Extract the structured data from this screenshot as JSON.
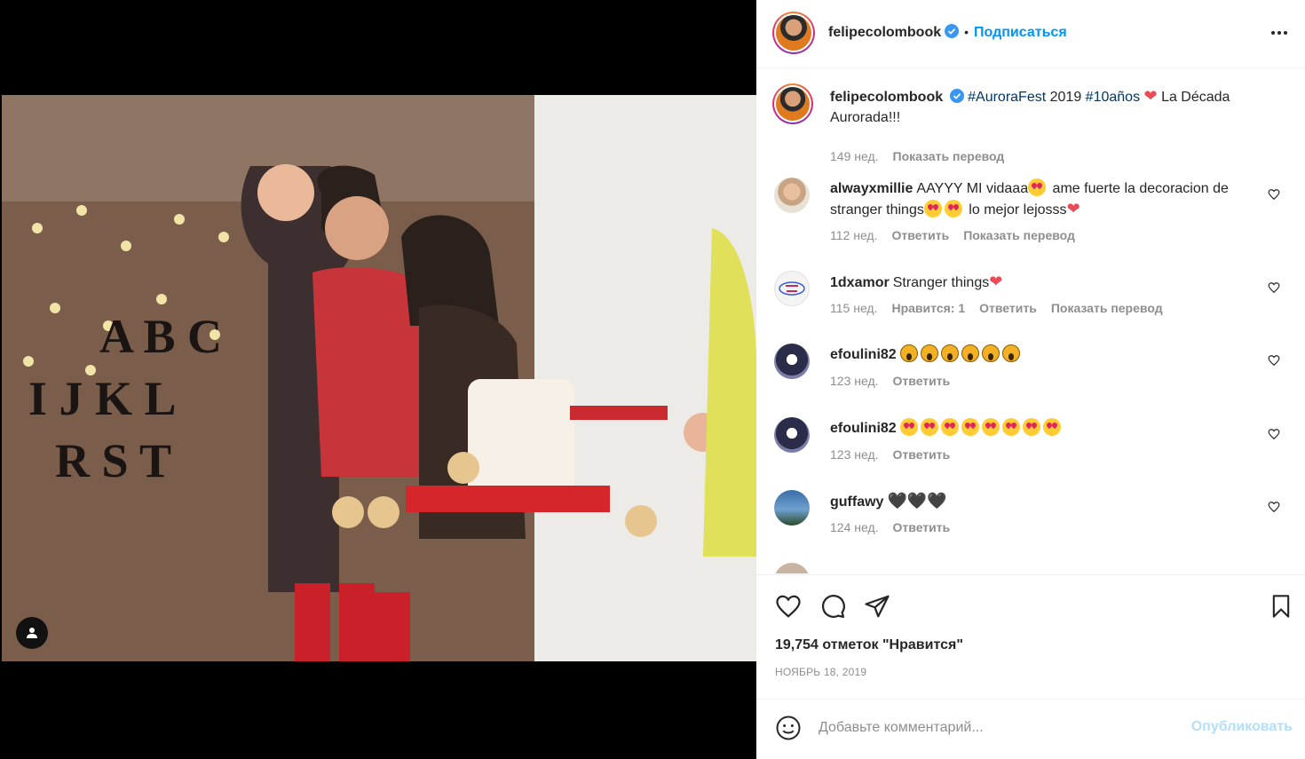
{
  "post": {
    "author": "felipecolombook",
    "follow_label": "Подписаться",
    "separator": "•"
  },
  "caption": {
    "username": "felipecolombook",
    "tag1": "#AuroraFest",
    "text1": "2019",
    "tag2": "#10años",
    "text2": "La Década Aurorada!!!",
    "time": "149 нед.",
    "translate": "Показать перевод"
  },
  "comments": [
    {
      "username": "alwayxmillie",
      "text_a": "AAYYY MI vidaaa",
      "text_b": "ame fuerte la decoracion de stranger things",
      "text_c": "lo mejor lejosss",
      "time": "112 нед.",
      "reply": "Ответить",
      "translate": "Показать перевод"
    },
    {
      "username": "1dxamor",
      "text": "Stranger things",
      "time": "115 нед.",
      "likes": "Нравится: 1",
      "reply": "Ответить",
      "translate": "Показать перевод"
    },
    {
      "username": "efoulini82",
      "time": "123 нед.",
      "reply": "Ответить"
    },
    {
      "username": "efoulini82",
      "time": "123 нед.",
      "reply": "Ответить"
    },
    {
      "username": "guffawy",
      "time": "124 нед.",
      "reply": "Ответить"
    }
  ],
  "stats": {
    "likes": "19,754 отметок \"Нравится\"",
    "date": "НОЯБРЬ 18, 2019"
  },
  "composer": {
    "placeholder": "Добавьте комментарий...",
    "publish": "Опубликовать"
  },
  "icons": {
    "verified": "verified-badge-icon",
    "like": "heart-icon",
    "comment": "comment-icon",
    "share": "paper-plane-icon",
    "save": "bookmark-icon",
    "emoji": "smiley-icon",
    "more": "more-horizontal-icon",
    "user_tag": "person-icon"
  },
  "colors": {
    "accent": "#0095f6",
    "muted": "#8e8e8e",
    "heart": "#ed4956",
    "publish_disabled": "#b2dffc"
  }
}
